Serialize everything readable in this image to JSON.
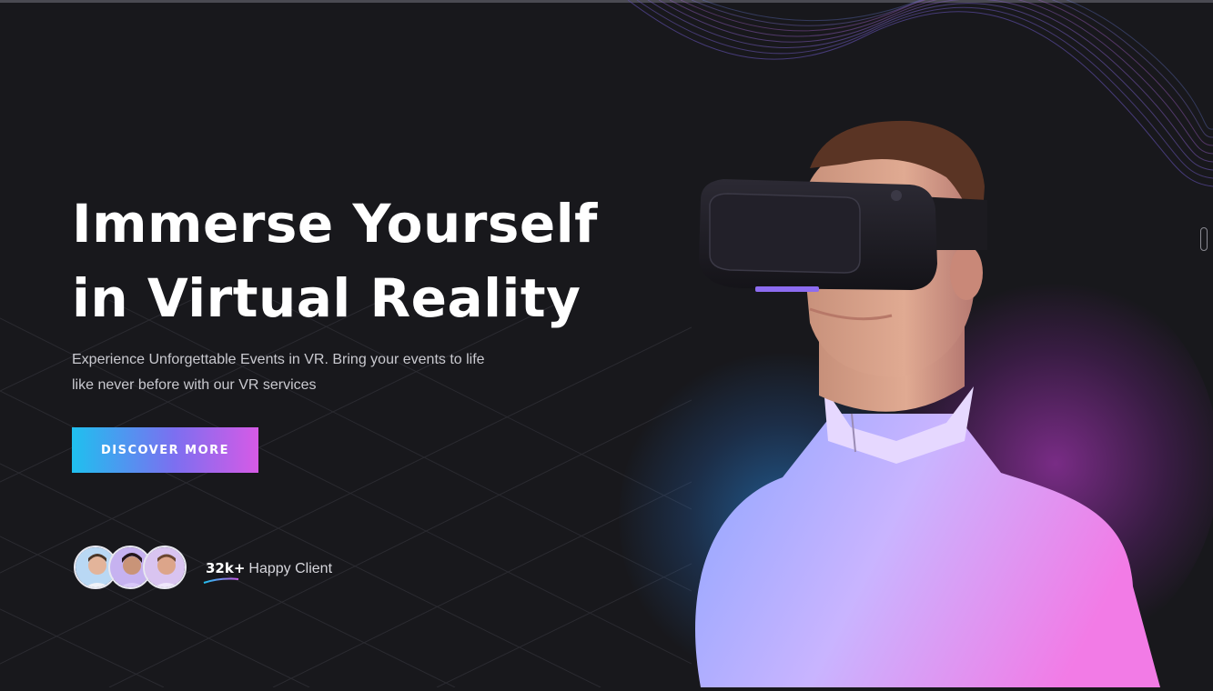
{
  "hero": {
    "title_line1": "Immerse Yourself",
    "title_line2": "in Virtual Reality",
    "subtitle": "Experience Unforgettable Events in VR. Bring your events to life like never before with our VR services",
    "cta_label": "DISCOVER MORE"
  },
  "social_proof": {
    "count": "32k+",
    "label": "Happy Client",
    "avatars": [
      "client-avatar-1",
      "client-avatar-2",
      "client-avatar-3"
    ]
  },
  "colors": {
    "background": "#18181c",
    "cta_gradient_start": "#1fc0ef",
    "cta_gradient_end": "#d65ae6",
    "glow_blue": "#288ce6",
    "glow_pink": "#c83cdc"
  },
  "icons": {
    "scroll_indicator": "scroll-indicator-icon"
  }
}
